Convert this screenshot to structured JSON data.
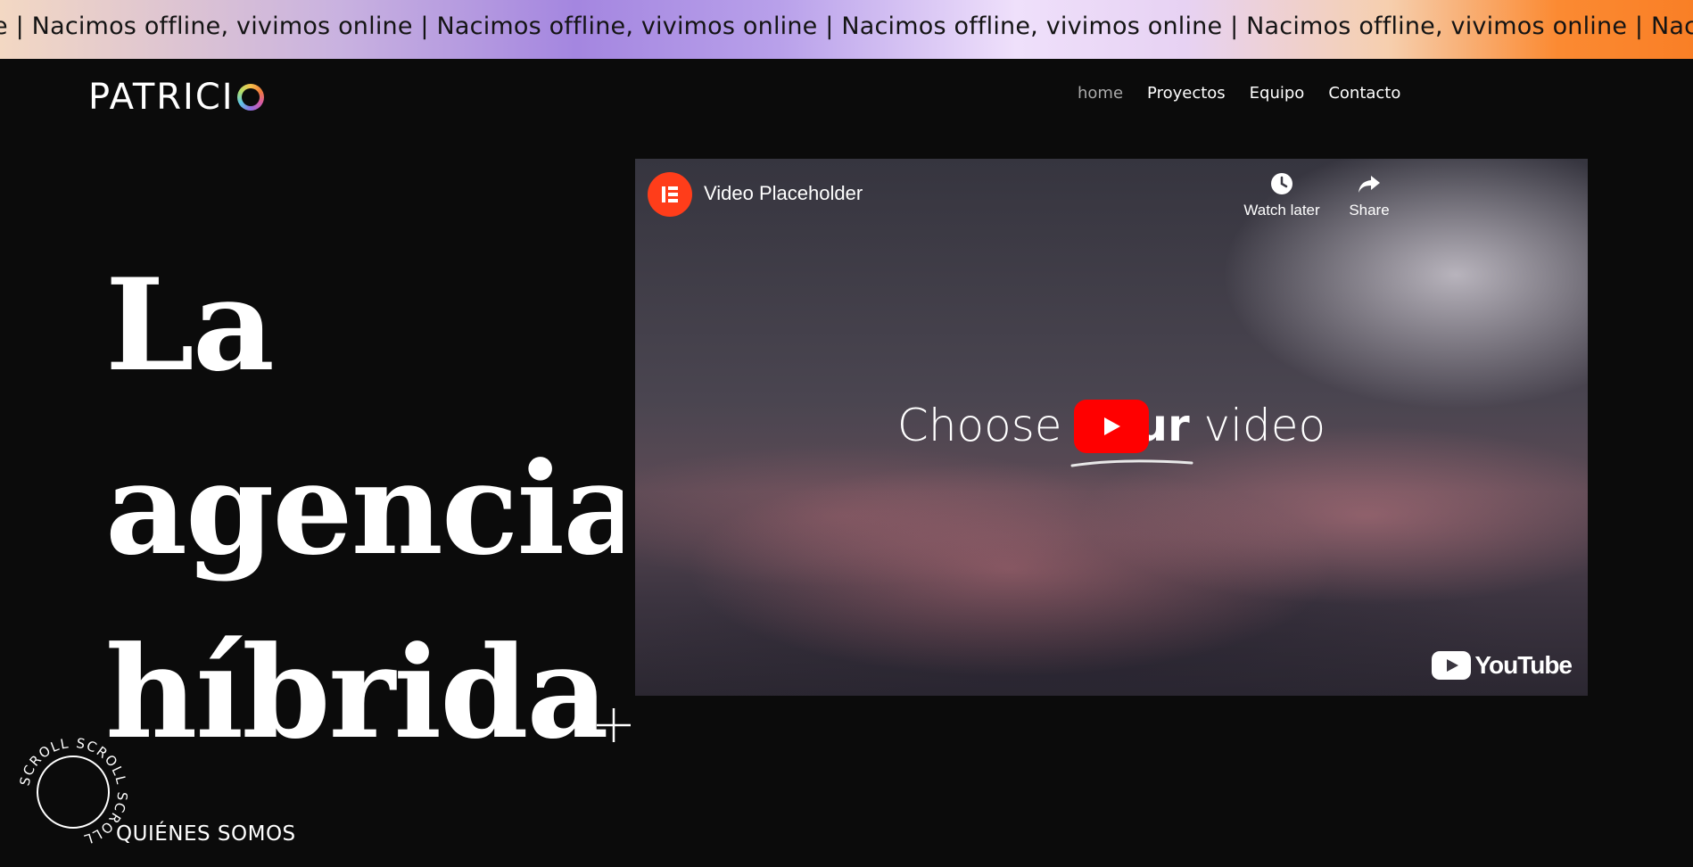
{
  "marquee": {
    "text": "e | Nacimos offline, vivimos online | Nacimos offline, vivimos online | Nacimos offline, vivimos online | Nacimos offline, vivimos online | Nacimos offline, vivimos online | Nacimos offline, vivimos online | Naci"
  },
  "header": {
    "logo_text": "PATRICI",
    "nav": [
      {
        "label": "home",
        "active": true
      },
      {
        "label": "Proyectos"
      },
      {
        "label": "Equipo"
      },
      {
        "label": "Contacto"
      }
    ]
  },
  "hero": {
    "lines": [
      "La",
      "agencia",
      "híbrida"
    ]
  },
  "video": {
    "title": "Video Placeholder",
    "watch_later": "Watch later",
    "share": "Share",
    "center_pre": "Choose ",
    "center_bold": "your",
    "center_post": " video",
    "brand": "YouTube"
  },
  "scroll": {
    "ring_text": "SCROLL SCROLL SCROLL",
    "label": "QUIÉNES SOMOS"
  },
  "colors": {
    "background": "#0b0b0b",
    "youtube_red": "#ff0000",
    "avatar_orange": "#ff3d1a"
  }
}
